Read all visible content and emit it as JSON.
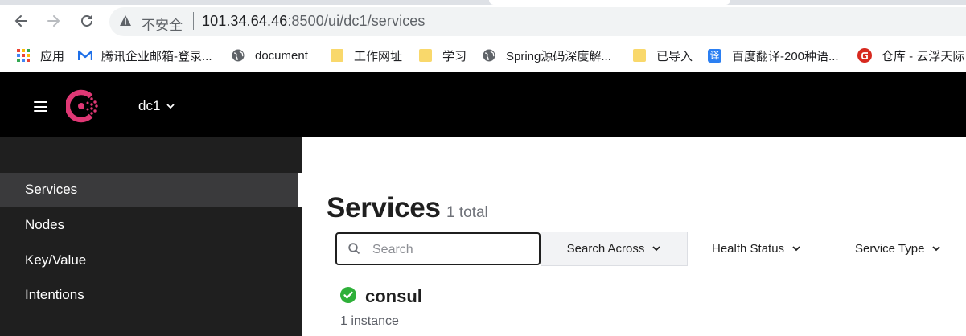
{
  "browser": {
    "insecure_label": "不安全",
    "url_host": "101.34.64.46",
    "url_rest": ":8500/ui/dc1/services",
    "bookmarks": [
      {
        "label": "应用",
        "icon": "apps-grid-icon"
      },
      {
        "label": "腾讯企业邮箱-登录...",
        "icon": "mail-icon"
      },
      {
        "label": "document",
        "icon": "globe-icon"
      },
      {
        "label": "工作网址",
        "icon": "folder-icon"
      },
      {
        "label": "学习",
        "icon": "folder-icon"
      },
      {
        "label": "Spring源码深度解...",
        "icon": "globe-icon"
      },
      {
        "label": "已导入",
        "icon": "folder-icon"
      },
      {
        "label": "百度翻译-200种语...",
        "icon": "translate-icon"
      },
      {
        "label": "仓库 - 云浮天际",
        "icon": "gitee-icon"
      }
    ]
  },
  "header": {
    "datacenter": "dc1",
    "brand_color": "#e03875"
  },
  "sidebar": {
    "items": [
      {
        "label": "Services",
        "active": true
      },
      {
        "label": "Nodes",
        "active": false
      },
      {
        "label": "Key/Value",
        "active": false
      },
      {
        "label": "Intentions",
        "active": false
      }
    ]
  },
  "main": {
    "title": "Services",
    "count": "1 total",
    "search_placeholder": "Search",
    "search_across": "Search Across",
    "health_status": "Health Status",
    "service_type": "Service Type",
    "services": [
      {
        "name": "consul",
        "instances": "1 instance",
        "status": "passing",
        "status_color": "#2eb039"
      }
    ]
  }
}
